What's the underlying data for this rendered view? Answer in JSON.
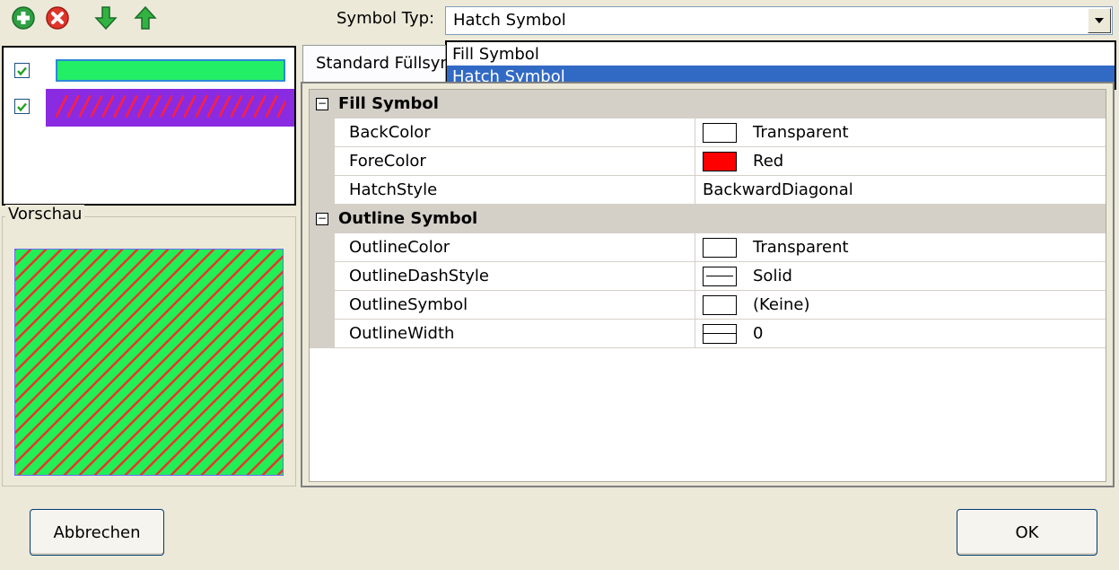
{
  "toolbar": {
    "icons": [
      "add-icon",
      "remove-icon",
      "move-down-icon",
      "move-up-icon"
    ]
  },
  "layers": [
    {
      "checked": true,
      "symbol": "fill",
      "color": "#22ee66",
      "border": "#2a8ad6"
    },
    {
      "checked": true,
      "symbol": "hatch",
      "color": "#8a2be2",
      "hatch_color": "#ff1f3d"
    }
  ],
  "preview": {
    "title": "Vorschau",
    "fill_color": "#22ee55",
    "hatch_color": "#e8342e"
  },
  "symbol_type": {
    "label": "Symbol Typ:",
    "value": "Hatch Symbol",
    "options": [
      "Fill Symbol",
      "Hatch Symbol"
    ],
    "selected_index": 1
  },
  "tab": {
    "label": "Standard Füllsymbol"
  },
  "property_grid": {
    "categories": [
      {
        "name": "Fill Symbol",
        "properties": [
          {
            "name": "BackColor",
            "value": "Transparent",
            "swatch": "#ffffff"
          },
          {
            "name": "ForeColor",
            "value": "Red",
            "swatch": "#ff0000"
          },
          {
            "name": "HatchStyle",
            "value": "BackwardDiagonal"
          }
        ]
      },
      {
        "name": "Outline Symbol",
        "properties": [
          {
            "name": "OutlineColor",
            "value": "Transparent",
            "swatch": "#ffffff"
          },
          {
            "name": "OutlineDashStyle",
            "value": "Solid",
            "swatch_icon": "dash-style-icon"
          },
          {
            "name": "OutlineSymbol",
            "value": "(Keine)",
            "swatch": "#ffffff"
          },
          {
            "name": "OutlineWidth",
            "value": "0",
            "swatch_icon": "line-width-icon"
          }
        ]
      }
    ]
  },
  "buttons": {
    "cancel": "Abbrechen",
    "ok": "OK"
  }
}
